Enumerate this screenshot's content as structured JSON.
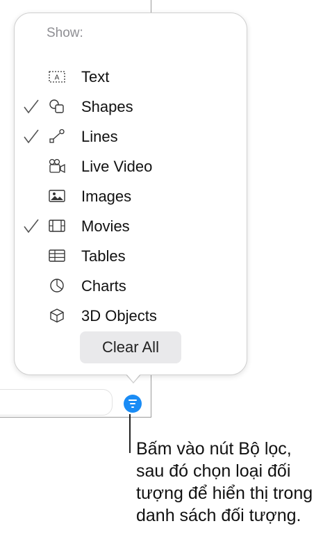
{
  "popover": {
    "header": "Show:",
    "items": [
      {
        "label": "Text",
        "icon": "text-box-icon",
        "checked": false
      },
      {
        "label": "Shapes",
        "icon": "shapes-icon",
        "checked": true
      },
      {
        "label": "Lines",
        "icon": "lines-icon",
        "checked": true
      },
      {
        "label": "Live Video",
        "icon": "live-video-icon",
        "checked": false
      },
      {
        "label": "Images",
        "icon": "image-icon",
        "checked": false
      },
      {
        "label": "Movies",
        "icon": "film-icon",
        "checked": true
      },
      {
        "label": "Tables",
        "icon": "table-icon",
        "checked": false
      },
      {
        "label": "Charts",
        "icon": "chart-icon",
        "checked": false
      },
      {
        "label": "3D Objects",
        "icon": "cube-icon",
        "checked": false
      }
    ],
    "clear_all_label": "Clear All"
  },
  "filter_button": {
    "icon": "filter-icon",
    "color": "#1a8cf5"
  },
  "callout": {
    "text": "Bấm vào nút Bộ lọc, sau đó chọn loại đối tượng để hiển thị trong danh sách đối tượng."
  }
}
